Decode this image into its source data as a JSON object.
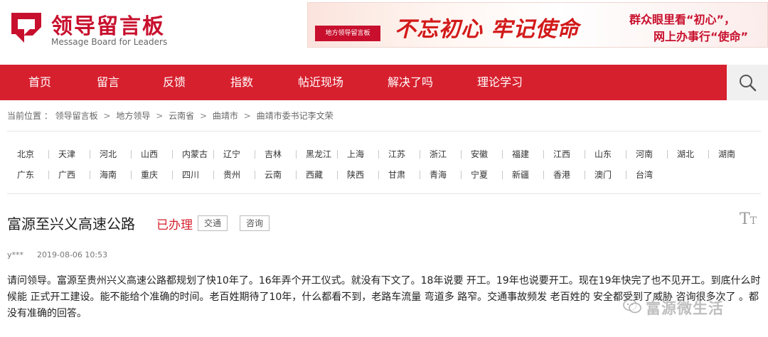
{
  "header": {
    "logo_cn": "领导留言板",
    "logo_en": "Message Board for Leaders",
    "banner": {
      "logo_text": "地方领导留言板",
      "slogan": "不忘初心 牢记使命",
      "line2": "群众眼里看“初心”，",
      "line3": "网上办事行“使命”"
    }
  },
  "nav": {
    "items": [
      "首页",
      "留言",
      "反馈",
      "指数",
      "帖近现场",
      "解决了吗",
      "理论学习"
    ],
    "search_icon": "search-icon"
  },
  "breadcrumb": {
    "prefix": "当前位置 ：",
    "items": [
      "领导留言板",
      "地方领导",
      "云南省",
      "曲靖市",
      "曲靖市委书记李文荣"
    ],
    "separator": ">"
  },
  "regions": {
    "row1": [
      "北京",
      "天津",
      "河北",
      "山西",
      "内蒙古",
      "辽宁",
      "吉林",
      "黑龙江",
      "上海",
      "江苏",
      "浙江",
      "安徽",
      "福建",
      "江西",
      "山东",
      "河南",
      "湖北",
      "湖南"
    ],
    "row2": [
      "广东",
      "广西",
      "海南",
      "重庆",
      "四川",
      "贵州",
      "云南",
      "西藏",
      "陕西",
      "甘肃",
      "青海",
      "宁夏",
      "新疆",
      "香港",
      "澳门",
      "台湾"
    ]
  },
  "message": {
    "title": "富源至兴义高速公路",
    "status": "已办理",
    "tags": [
      "交通",
      "咨询"
    ],
    "font_toggle": "T",
    "author": "y***",
    "time": "2019-08-06 10:53",
    "body": "请问领导。富源至贵州兴义高速公路都规划了快10年了。16年弄个开工仪式。就没有下文了。18年说要 开工。19年也说要开工。现在19年快完了也不见开工。到底什么时候能 正式开工建设。能不能给个准确的时间。老百姓期待了10年，什么都看不到，老路车流量 弯道多 路窄。交通事故频发 老百姓的 安全都受到了威胁 咨询很多次了 。都没有准确的回答。"
  },
  "watermark": {
    "text": "富源微生活"
  },
  "colors": {
    "brand_red": "#d7202e",
    "logo_red": "#c8102e"
  }
}
